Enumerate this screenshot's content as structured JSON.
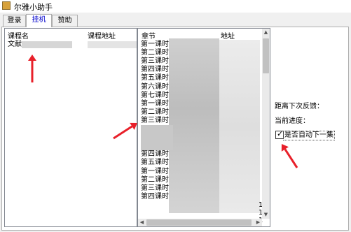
{
  "window": {
    "title": "尔雅小助手",
    "icon": "app-icon"
  },
  "tabs": [
    {
      "label": "登录",
      "active": false
    },
    {
      "label": "挂机",
      "active": true
    },
    {
      "label": "赞助",
      "active": false
    }
  ],
  "course_list": {
    "columns": [
      "课程名",
      "课程地址"
    ],
    "rows": [
      {
        "name": "文献",
        "address": ""
      }
    ]
  },
  "chapter_list": {
    "columns": [
      "章节",
      "地址"
    ],
    "rows": [
      "第一课时",
      "第二课时",
      "第三课时",
      "第四课时",
      "第五课时",
      "第六课时",
      "第七课时",
      "第一课时",
      "第二课时",
      "第三课时",
      "",
      "",
      "",
      "第四课时",
      "第五课时",
      " 第一课时",
      "第二课时",
      "第三课时",
      "第四课时"
    ],
    "edge_digits": [
      "1",
      "1",
      "1"
    ]
  },
  "status_panel": {
    "next_feedback_label": "距离下次反馈：",
    "progress_label": "当前进度：",
    "auto_next_label": "是否自动下一集",
    "auto_next_checked": true,
    "check_mark": "✓"
  },
  "annotation_color": "#e8202a"
}
